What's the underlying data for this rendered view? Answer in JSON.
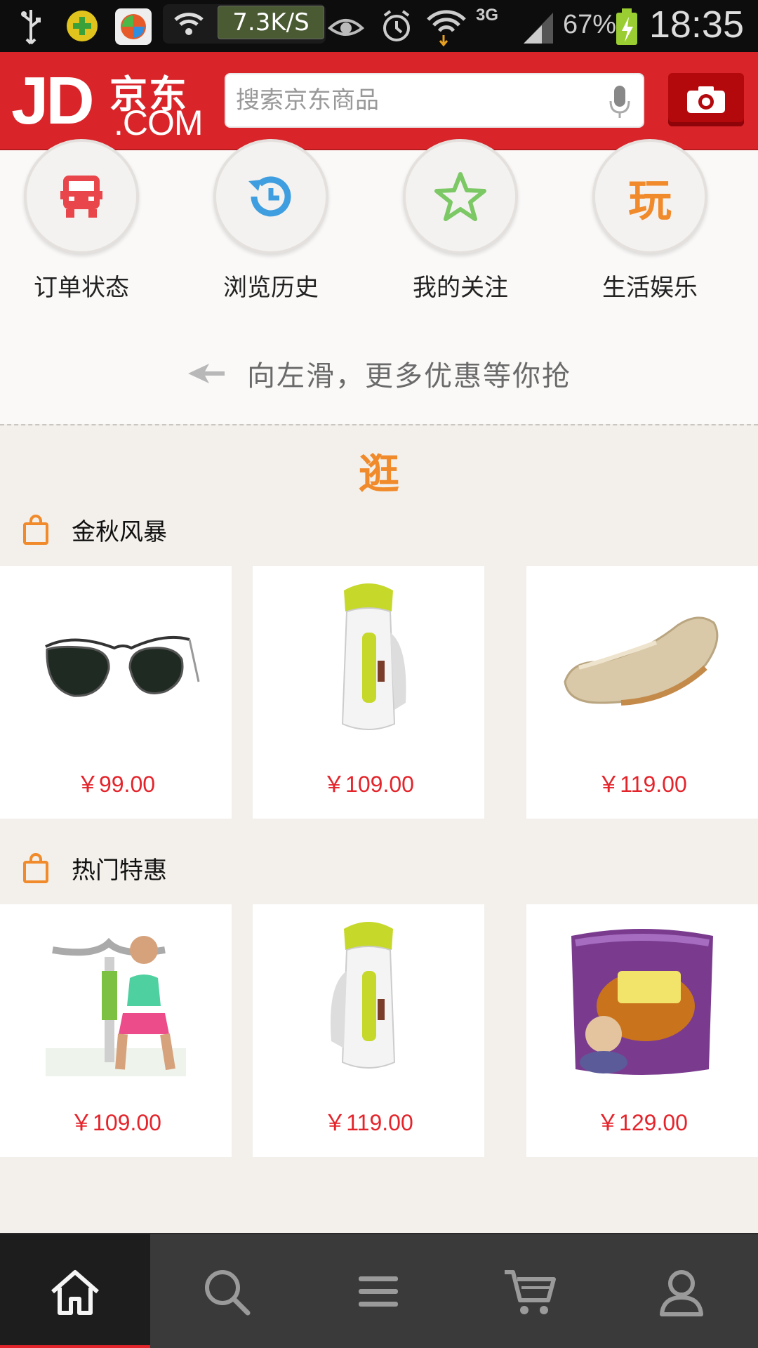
{
  "status_bar": {
    "network_speed": "7.3K/S",
    "network_type": "3G",
    "battery": "67%",
    "time": "18:35"
  },
  "header": {
    "logo_jd": "JD",
    "logo_cn": "京东",
    "logo_com": ".COM",
    "search_placeholder": "搜索京东商品"
  },
  "quick_actions": [
    {
      "label": "订单状态",
      "icon": "truck-icon",
      "color": "#e8464a"
    },
    {
      "label": "浏览历史",
      "icon": "history-clock-icon",
      "color": "#3e9ee0"
    },
    {
      "label": "我的关注",
      "icon": "star-icon",
      "color": "#7bc865"
    },
    {
      "label": "生活娱乐",
      "icon": "play-char-icon",
      "glyph": "玩",
      "color": "#f08a2a"
    }
  ],
  "swipe_hint": "向左滑，更多优惠等你抢",
  "guang_label": "逛",
  "sections": [
    {
      "title": "金秋风暴",
      "products": [
        {
          "image": "sunglasses",
          "price": "￥99.00"
        },
        {
          "image": "garment-steamer",
          "price": "￥109.00"
        },
        {
          "image": "gold-flat-shoe",
          "price": "￥119.00"
        }
      ]
    },
    {
      "title": "热门特惠",
      "products": [
        {
          "image": "fitness-equipment",
          "price": "￥109.00"
        },
        {
          "image": "garment-steamer",
          "price": "￥119.00"
        },
        {
          "image": "instant-noodles-pack",
          "price": "￥129.00"
        }
      ]
    }
  ],
  "bottom_nav": [
    {
      "name": "home",
      "icon": "home-icon",
      "active": true
    },
    {
      "name": "search",
      "icon": "search-icon",
      "active": false
    },
    {
      "name": "categories",
      "icon": "menu-icon",
      "active": false
    },
    {
      "name": "cart",
      "icon": "cart-icon",
      "active": false
    },
    {
      "name": "account",
      "icon": "user-icon",
      "active": false
    }
  ],
  "colors": {
    "brand_red": "#d9252a",
    "price_red": "#e4242b",
    "accent_orange": "#f08a2a"
  }
}
